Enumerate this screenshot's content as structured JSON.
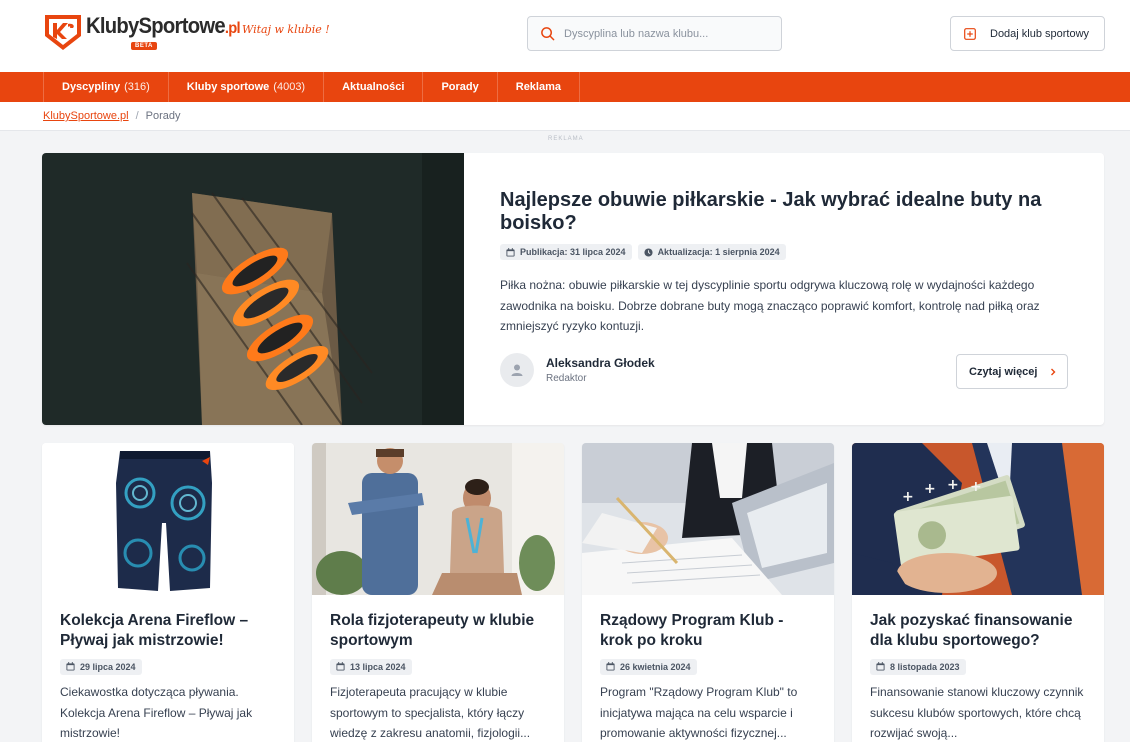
{
  "header": {
    "logo_text": "KlubySportowe",
    "logo_tld": ".pl",
    "logo_badge": "BETA",
    "tagline": "Witaj w klubie !",
    "search_placeholder": "Dyscyplina lub nazwa klubu...",
    "add_button": "Dodaj klub sportowy"
  },
  "nav": [
    {
      "label": "Dyscypliny",
      "count": "(316)"
    },
    {
      "label": "Kluby sportowe",
      "count": "(4003)"
    },
    {
      "label": "Aktualności",
      "count": ""
    },
    {
      "label": "Porady",
      "count": ""
    },
    {
      "label": "Reklama",
      "count": ""
    }
  ],
  "breadcrumb": {
    "home": "KlubySportowe.pl",
    "separator": "/",
    "current": "Porady"
  },
  "ad_label": "REKLAMA",
  "featured": {
    "title": "Najlepsze obuwie piłkarskie - Jak wybrać idealne buty na boisko?",
    "published": "Publikacja: 31 lipca 2024",
    "updated": "Aktualizacja: 1 sierpnia 2024",
    "description": "Piłka nożna: obuwie piłkarskie w tej dyscyplinie sportu odgrywa kluczową rolę w wydajności każdego zawodnika na boisku. Dobrze dobrane buty mogą znacząco poprawić komfort, kontrolę nad piłką oraz zmniejszyć ryzyko kontuzji.",
    "author": "Aleksandra Głodek",
    "author_role": "Redaktor",
    "read_more": "Czytaj więcej"
  },
  "cards": [
    {
      "title": "Kolekcja Arena Fireflow – Pływaj jak mistrzowie!",
      "date": "29 lipca 2024",
      "description": "Ciekawostka dotycząca pływania. Kolekcja Arena Fireflow – Pływaj jak mistrzowie!"
    },
    {
      "title": "Rola fizjoterapeuty w klubie sportowym",
      "date": "13 lipca 2024",
      "description": "Fizjoterapeuta pracujący w klubie sportowym to specjalista, który łączy wiedzę z zakresu anatomii, fizjologii..."
    },
    {
      "title": "Rządowy Program Klub - krok po kroku",
      "date": "26 kwietnia 2024",
      "description": "Program \"Rządowy Program Klub\" to inicjatywa mająca na celu wsparcie i promowanie aktywności fizycznej..."
    },
    {
      "title": "Jak pozyskać finansowanie dla klubu sportowego?",
      "date": "8 listopada 2023",
      "description": "Finansowanie stanowi kluczowy czynnik sukcesu klubów sportowych, które chcą rozwijać swoją..."
    }
  ],
  "colors": {
    "accent": "#e8450f",
    "background": "#f3f4f6",
    "text": "#1f2937"
  },
  "icons": {
    "search": "search-icon",
    "add": "plus-square-icon",
    "calendar": "calendar-icon",
    "clock": "clock-icon",
    "user": "user-icon",
    "chevron": "chevron-right-icon"
  }
}
